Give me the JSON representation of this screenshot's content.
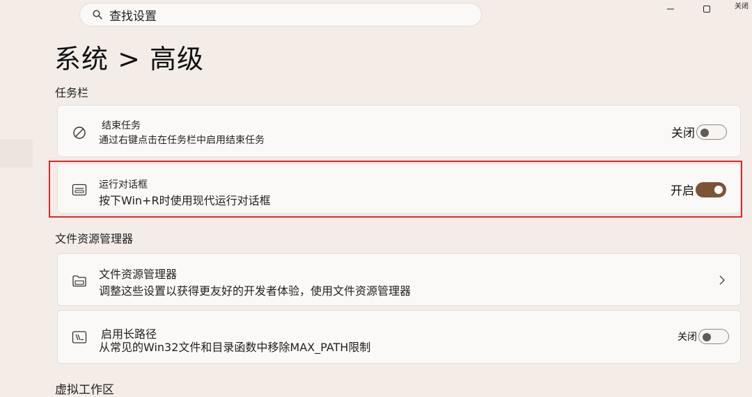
{
  "search": {
    "placeholder": "查找设置"
  },
  "window": {
    "close_label": "关闭"
  },
  "page": {
    "title": "系统 > 高级"
  },
  "sections": {
    "taskbar": "任务栏",
    "file_explorer": "文件资源管理器",
    "virtual_workspace": "虚拟工作区"
  },
  "cards": {
    "end_task": {
      "title": "结束任务",
      "desc": "通过右键点击在任务栏中启用结束任务",
      "toggle_label": "关闭",
      "toggle_on": false,
      "icon": "prohibited-icon"
    },
    "run_dialog": {
      "title": "运行对话框",
      "desc": "按下Win+R时使用现代运行对话框",
      "toggle_label": "开启",
      "toggle_on": true,
      "icon": "run-window-icon"
    },
    "file_explorer": {
      "title": "文件资源管理器",
      "desc": "调整这些设置以获得更友好的开发者体验，使用文件资源管理器",
      "icon": "folder-icon"
    },
    "long_paths": {
      "title": "启用长路径",
      "desc": "从常见的Win32文件和目录函数中移除MAX_PATH限制",
      "toggle_label": "关闭",
      "toggle_on": false,
      "icon": "long-path-icon"
    }
  },
  "colors": {
    "background": "#f3ece7",
    "card": "#fbf9f7",
    "toggle_on": "#7c5334",
    "highlight": "#e0262a"
  }
}
